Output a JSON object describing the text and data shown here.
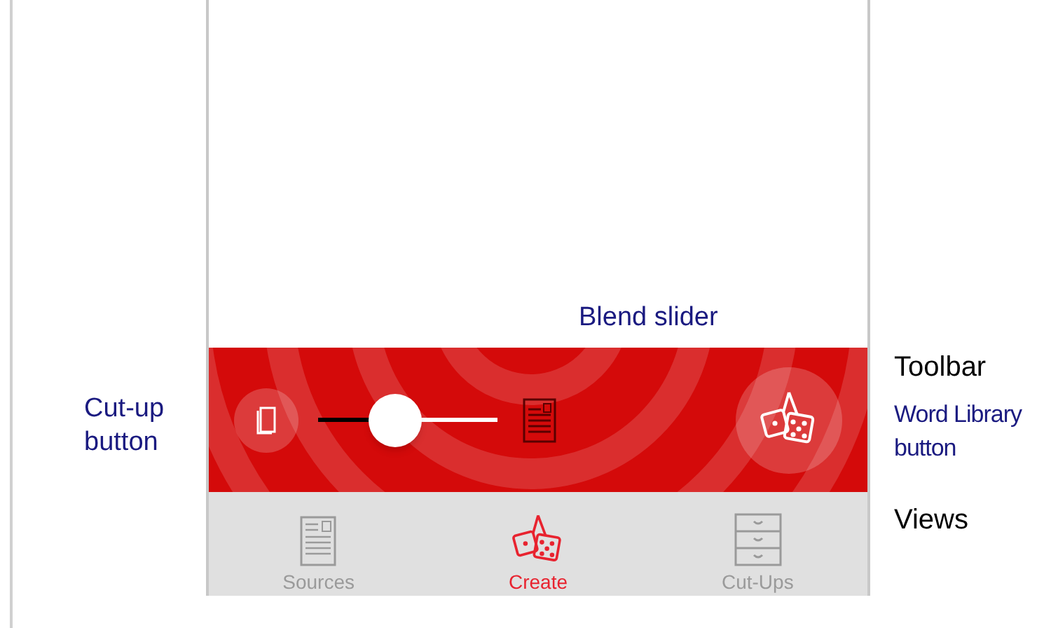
{
  "annotations": [
    {
      "kind": "control",
      "text": "Blend slider"
    },
    {
      "kind": "control",
      "text": "Cut-up button"
    },
    {
      "kind": "region",
      "text": "Toolbar"
    },
    {
      "kind": "control",
      "text": "Word Library button"
    },
    {
      "kind": "region",
      "text": "Views"
    }
  ],
  "toolbar": {
    "slider": {
      "level": 0.43
    }
  },
  "tabs": [
    {
      "label": "Sources",
      "kind": "document",
      "selected": false
    },
    {
      "label": "Create",
      "kind": "dice",
      "selected": true
    },
    {
      "label": "Cut-Ups",
      "kind": "cabinet",
      "selected": false
    }
  ]
}
